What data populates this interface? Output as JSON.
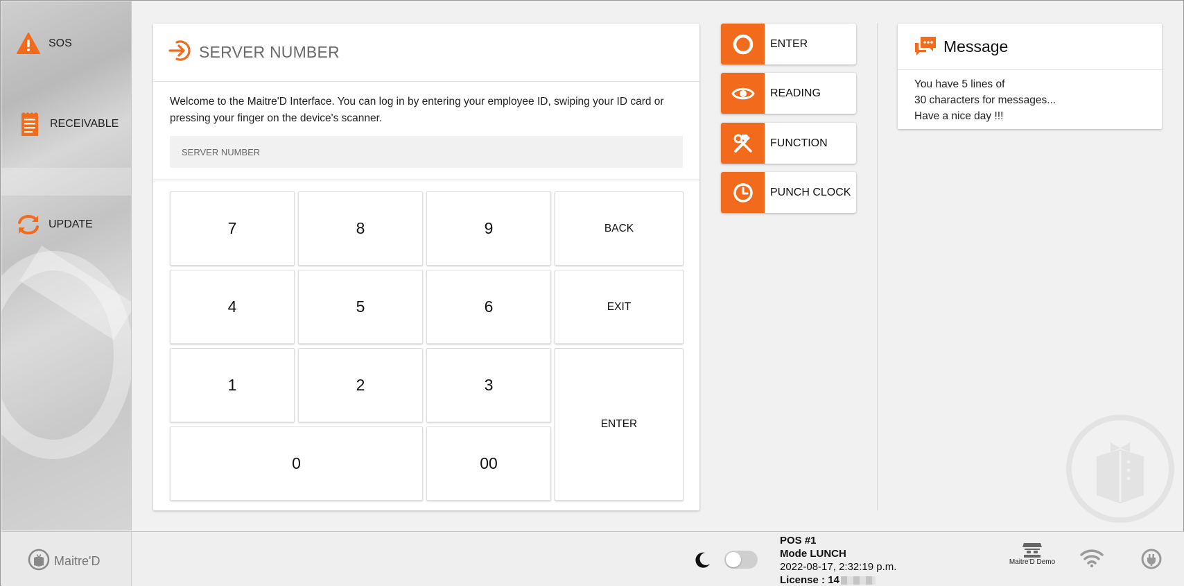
{
  "colors": {
    "accent": "#f26a1b",
    "background": "#f1f1f1",
    "card": "#ffffff"
  },
  "sidebar": {
    "items": [
      {
        "label": "SOS",
        "icon": "warning-icon"
      },
      {
        "label": "RECEIVABLE",
        "icon": "receipt-icon"
      },
      {
        "label": "UPDATE",
        "icon": "sync-icon"
      }
    ]
  },
  "login": {
    "title": "SERVER NUMBER",
    "welcome": "Welcome to the Maitre'D Interface. You can log in by entering your employee ID, swiping your ID card or pressing your finger on the device's scanner.",
    "input_placeholder": "SERVER NUMBER",
    "keys": {
      "k7": "7",
      "k8": "8",
      "k9": "9",
      "back": "BACK",
      "k4": "4",
      "k5": "5",
      "k6": "6",
      "exit": "EXIT",
      "k1": "1",
      "k2": "2",
      "k3": "3",
      "enter": "ENTER",
      "k0": "0",
      "k00": "00"
    }
  },
  "actions": [
    {
      "label": "ENTER",
      "icon": "circle-icon"
    },
    {
      "label": "READING",
      "icon": "eye-icon"
    },
    {
      "label": "FUNCTION",
      "icon": "tools-icon"
    },
    {
      "label": "PUNCH CLOCK",
      "icon": "clock-icon"
    }
  ],
  "message": {
    "title": "Message",
    "lines": [
      "You have 5 lines of",
      "30 characters for messages...",
      "Have a nice day !!!"
    ]
  },
  "footer": {
    "brand": "Maitre'D",
    "pos": "POS #1",
    "mode": "Mode LUNCH",
    "datetime": "2022-08-17, 2:32:19 p.m.",
    "license_label": "License : 14",
    "demo_label": "Maitre'D Demo"
  }
}
